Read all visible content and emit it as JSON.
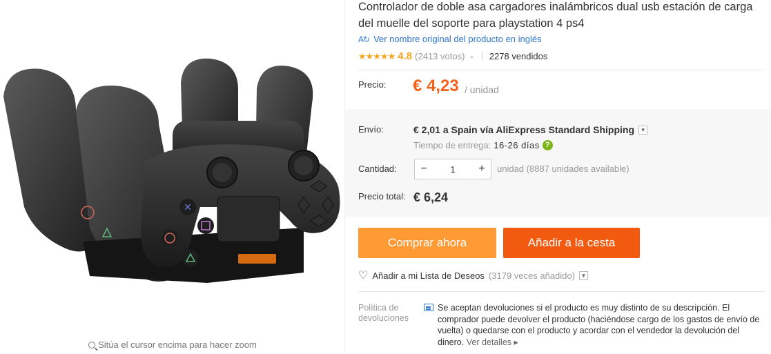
{
  "product": {
    "title": "Controlador de doble asa cargadores inalámbricos dual usb estación de carga del muelle del soporte para playstation 4 ps4",
    "original_name_link": "Ver nombre original del producto en inglés",
    "rating": "4.8",
    "votes": "(2413 votos)",
    "sold": "2278 vendidos",
    "icons": {
      "translate": "translate-icon",
      "rating_chevron": "chevron-down-icon"
    }
  },
  "price": {
    "label": "Precio:",
    "value": "€ 4,23",
    "unit": "/ unidad"
  },
  "shipping": {
    "label": "Envío:",
    "value": "€ 2,01 a Spain vía AliExpress Standard Shipping",
    "delivery_label": "Tiempo de entrega:",
    "delivery_days": "16-26 días",
    "help": "?"
  },
  "quantity": {
    "label": "Cantidad:",
    "value": "1",
    "minus": "−",
    "plus": "+",
    "available": "unidad (8887 unidades available)"
  },
  "total": {
    "label": "Precio total:",
    "value": "€ 6,24"
  },
  "actions": {
    "buy_now": "Comprar ahora",
    "add_to_cart": "Añadir a la cesta",
    "wishlist": "Añadir a mi Lista de Deseos",
    "wishlist_count": "(3179 veces añadido)"
  },
  "policy": {
    "label": "Política de devoluciones",
    "text": "Se aceptan devoluciones si el producto es muy distinto de su descripción. El comprador puede devolver el producto (haciéndose cargo de los gastos de envío de vuelta) o quedarse con el producto y acordar con el vendedor la devolución del dinero.",
    "more": "Ver detalles ▸"
  },
  "gallery": {
    "zoom_hint": "Sitúa el cursor encima para hacer zoom"
  },
  "colors": {
    "price": "#f3621d",
    "buy_button": "#ff9a35",
    "cart_button": "#f25a0f",
    "link": "#2e74c9",
    "stars": "#f5a623"
  }
}
